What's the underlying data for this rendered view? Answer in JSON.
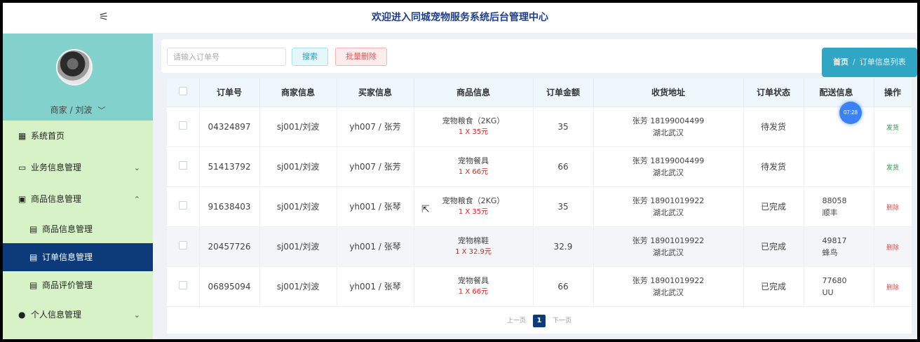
{
  "header": {
    "menu_icon": "sliders-icon",
    "title": "欢迎进入同城宠物服务系统后台管理中心"
  },
  "profile": {
    "role_label": "商家 / 刘波"
  },
  "sidebar": {
    "items": [
      {
        "icon": "grid-icon",
        "label": "系统首页"
      },
      {
        "icon": "folder-icon",
        "label": "业务信息管理",
        "expanded": false
      },
      {
        "icon": "folder-check-icon",
        "label": "商品信息管理",
        "expanded": true
      },
      {
        "icon": "doc-icon",
        "label": "商品信息管理",
        "sub": true
      },
      {
        "icon": "doc-icon",
        "label": "订单信息管理",
        "sub": true,
        "active": true
      },
      {
        "icon": "doc-icon",
        "label": "商品评价管理",
        "sub": true
      },
      {
        "icon": "user-icon",
        "label": "个人信息管理",
        "expanded": false
      }
    ]
  },
  "toolbar": {
    "search_placeholder": "请输入订单号",
    "search_label": "搜索",
    "batch_delete_label": "批量删除"
  },
  "breadcrumb": {
    "home": "首页",
    "separator": "/",
    "current": "订单信息列表"
  },
  "table": {
    "headers": [
      "订单号",
      "商家信息",
      "买家信息",
      "商品信息",
      "订单金额",
      "收货地址",
      "订单状态",
      "配送信息",
      "操作"
    ],
    "rows": [
      {
        "order_no": "04324897",
        "merchant": "sj001/刘波",
        "buyer": "yh007 / 张芳",
        "goods_name": "宠物粮食（2KG）",
        "goods_qty": "1 X 35元",
        "amount": "35",
        "addr_line1": "张芳 18199004499",
        "addr_line2": "湖北武汉",
        "status": "待发货",
        "ship_line1": "",
        "ship_line2": "",
        "action": "发货"
      },
      {
        "order_no": "51413792",
        "merchant": "sj001/刘波",
        "buyer": "yh007 / 张芳",
        "goods_name": "宠物餐具",
        "goods_qty": "1 X 66元",
        "amount": "66",
        "addr_line1": "张芳 18199004499",
        "addr_line2": "湖北武汉",
        "status": "待发货",
        "ship_line1": "",
        "ship_line2": "",
        "action": "发货"
      },
      {
        "order_no": "91638403",
        "merchant": "sj001/刘波",
        "buyer": "yh001 / 张琴",
        "goods_name": "宠物粮食（2KG）",
        "goods_qty": "1 X 35元",
        "amount": "35",
        "addr_line1": "张芳 18901019922",
        "addr_line2": "湖北武汉",
        "status": "已完成",
        "ship_line1": "88058",
        "ship_line2": "顺丰",
        "action": "删除"
      },
      {
        "order_no": "20457726",
        "merchant": "sj001/刘波",
        "buyer": "yh001 / 张琴",
        "goods_name": "宠物棉鞋",
        "goods_qty": "1 X 32.9元",
        "amount": "32.9",
        "addr_line1": "张芳 18901019922",
        "addr_line2": "湖北武汉",
        "status": "已完成",
        "ship_line1": "49817",
        "ship_line2": "蜂鸟",
        "action": "删除"
      },
      {
        "order_no": "06895094",
        "merchant": "sj001/刘波",
        "buyer": "yh001 / 张琴",
        "goods_name": "宠物餐具",
        "goods_qty": "1 X 66元",
        "amount": "66",
        "addr_line1": "张芳 18901019922",
        "addr_line2": "湖北武汉",
        "status": "已完成",
        "ship_line1": "77680",
        "ship_line2": "UU",
        "action": "删除"
      }
    ]
  },
  "pagination": {
    "prev": "上一页",
    "current": "1",
    "next": "下一页"
  },
  "overlay": {
    "time_badge": "07:28"
  },
  "colors": {
    "brand_dark": "#0d3b7a",
    "accent_teal": "#2fa7c4",
    "sidebar_bg": "#d8f2c8",
    "danger": "#e24a4a",
    "success": "#2e9a4a"
  }
}
